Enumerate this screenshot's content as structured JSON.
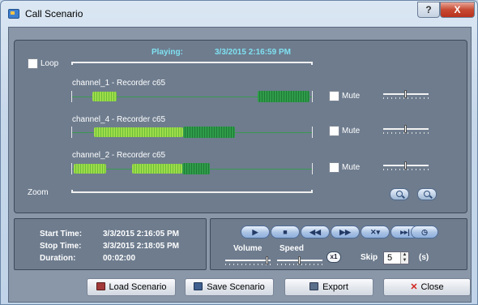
{
  "window": {
    "title": "Call Scenario",
    "help_label": "?",
    "close_label": "X"
  },
  "player": {
    "playing_label": "Playing:",
    "playing_time": "3/3/2015 2:16:59 PM",
    "loop_label": "Loop",
    "zoom_label": "Zoom",
    "mute_label": "Mute",
    "tracks": [
      {
        "name": "channel_1 - Recorder c65"
      },
      {
        "name": "channel_4 - Recorder c65"
      },
      {
        "name": "channel_2 - Recorder c65"
      }
    ]
  },
  "info": {
    "start_label": "Start Time:",
    "start_value": "3/3/2015 2:16:05 PM",
    "stop_label": "Stop Time:",
    "stop_value": "3/3/2015 2:18:05 PM",
    "duration_label": "Duration:",
    "duration_value": "00:02:00"
  },
  "controls": {
    "volume_label": "Volume",
    "speed_label": "Speed",
    "speed_multiplier": "x1",
    "skip_label": "Skip",
    "skip_value": "5",
    "skip_unit": "(s)"
  },
  "buttons": {
    "load": "Load Scenario",
    "save": "Save Scenario",
    "export": "Export",
    "close": "Close"
  },
  "icons": [
    "app-icon",
    "play-icon",
    "stop-icon",
    "rewind-icon",
    "fast-forward-icon",
    "skip-remove-icon",
    "skip-end-icon",
    "clock-icon",
    "zoom-in-icon",
    "zoom-out-icon"
  ]
}
